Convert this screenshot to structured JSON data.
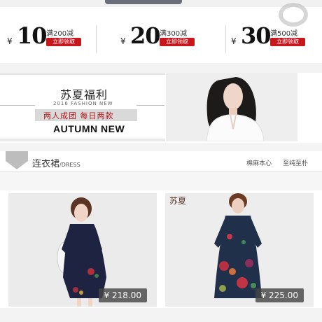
{
  "coupons": [
    {
      "currency": "¥",
      "amount": "10",
      "condition": "满200减",
      "button": "立即领取"
    },
    {
      "currency": "¥",
      "amount": "20",
      "condition": "满300减",
      "button": "立即领取"
    },
    {
      "currency": "¥",
      "amount": "30",
      "condition": "满500减",
      "button": "立即领取"
    }
  ],
  "banner": {
    "title": "苏夏福利",
    "subtitle": "2016 FASHION NEW",
    "promo": "两人成团   每日两款",
    "headline": "AUTUMN NEW"
  },
  "section": {
    "name": "连衣裙",
    "name_en": "/DRESS",
    "tags": [
      "棉麻本心",
      "至纯至朴"
    ]
  },
  "products": [
    {
      "price": "¥ 218.00",
      "brand": ""
    },
    {
      "price": "¥ 225.00",
      "brand": "苏夏"
    }
  ],
  "colors": {
    "accent": "#c8161d",
    "price_bg": "#464646"
  }
}
